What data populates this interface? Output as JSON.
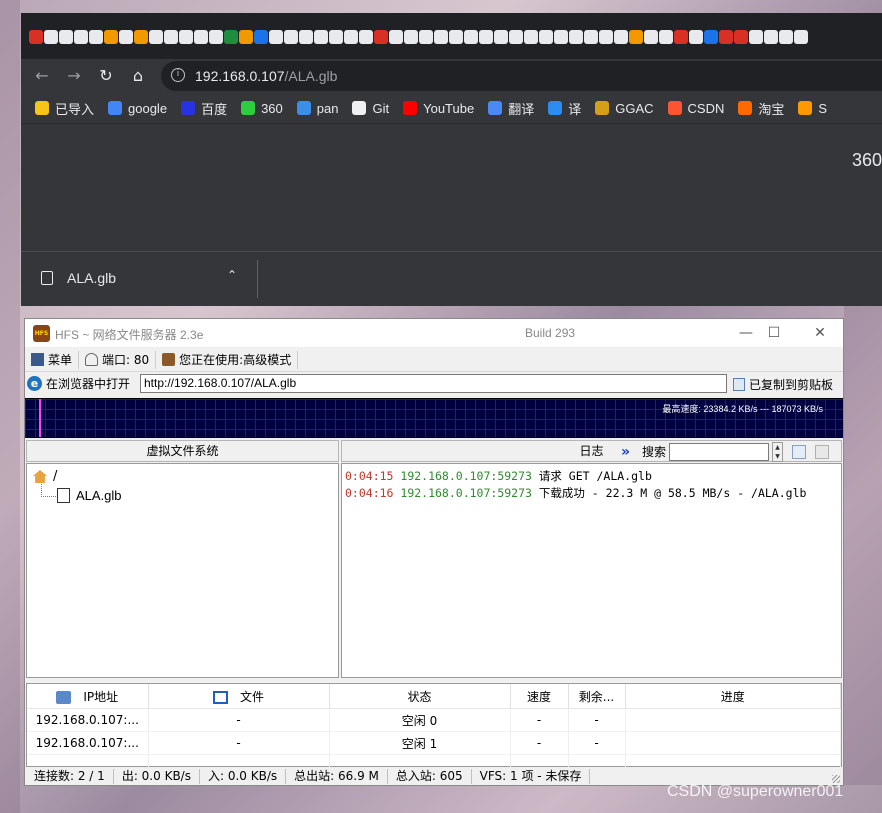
{
  "browser": {
    "address_host": "192.168.0.107",
    "address_path": "/ALA.glb",
    "bookmarks": [
      {
        "label": "已导入",
        "icon": "folder-icon",
        "color": "#f5c518"
      },
      {
        "label": "google",
        "icon": "google-icon",
        "color": "#4285f4"
      },
      {
        "label": "百度",
        "icon": "baidu-icon",
        "color": "#2932e1"
      },
      {
        "label": "360",
        "icon": "360-icon",
        "color": "#2ecc40"
      },
      {
        "label": "pan",
        "icon": "pan-icon",
        "color": "#3b8fe8"
      },
      {
        "label": "Git",
        "icon": "github-icon",
        "color": "#f0f0f0"
      },
      {
        "label": "YouTube",
        "icon": "youtube-icon",
        "color": "#ff0000"
      },
      {
        "label": "翻译",
        "icon": "translate-icon",
        "color": "#4a8af4"
      },
      {
        "label": "译",
        "icon": "translate-icon",
        "color": "#2d8cf0"
      },
      {
        "label": "GGAC",
        "icon": "ggac-icon",
        "color": "#d4a017"
      },
      {
        "label": "CSDN",
        "icon": "csdn-icon",
        "color": "#fc5531"
      },
      {
        "label": "淘宝",
        "icon": "taobao-icon",
        "color": "#ff6a00"
      },
      {
        "label": "S",
        "icon": "triangle-icon",
        "color": "#ff9900"
      }
    ],
    "content_text": "360",
    "download": {
      "filename": "ALA.glb"
    }
  },
  "hfs": {
    "title": "HFS ~ 网络文件服务器 2.3e",
    "build": "Build 293",
    "menu": {
      "menu_label": "菜单",
      "port_label": "端口: 80",
      "mode_label": "您正在使用:高级模式"
    },
    "open_in_browser": "在浏览器中打开",
    "url": "http://192.168.0.107/ALA.glb",
    "copied_label": "已复制到剪贴板",
    "graph_text": "最高速度: 23384.2 KB/s --- 187073 KB/s",
    "vfs_header": "虚拟文件系统",
    "vfs_root": "/",
    "vfs_file": "ALA.glb",
    "log_header": "日志",
    "search_label": "搜索",
    "log": [
      {
        "time": "0:04:15",
        "addr": "192.168.0.107:59273",
        "msg": "请求 GET /ALA.glb"
      },
      {
        "time": "0:04:16",
        "addr": "192.168.0.107:59273",
        "msg": "下载成功 - 22.3 M @ 58.5 MB/s - /ALA.glb"
      }
    ],
    "connections": {
      "columns": [
        "IP地址",
        "文件",
        "状态",
        "速度",
        "剩余...",
        "进度"
      ],
      "rows": [
        [
          "192.168.0.107:...",
          "-",
          "空闲 0",
          "-",
          "-",
          ""
        ],
        [
          "192.168.0.107:...",
          "-",
          "空闲 1",
          "-",
          "-",
          ""
        ]
      ]
    },
    "status": {
      "connections": "连接数: 2 / 1",
      "out_speed": "出: 0.0 KB/s",
      "in_speed": "入: 0.0 KB/s",
      "total_out": "总出站: 66.9 M",
      "total_in": "总入站: 605",
      "vfs": "VFS: 1 项 - 未保存"
    }
  },
  "watermark": "CSDN @superowner001"
}
